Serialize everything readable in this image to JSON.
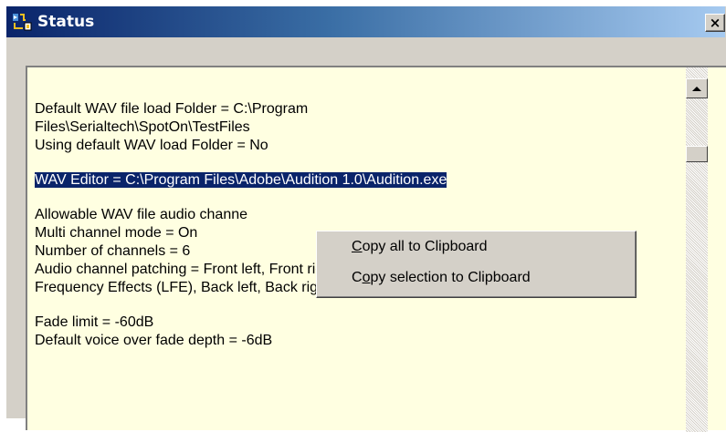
{
  "window": {
    "title": "Status",
    "close_label": "×"
  },
  "status_text": {
    "lines": [
      "Default WAV file load Folder = C:\\Program",
      "Files\\Serialtech\\SpotOn\\TestFiles",
      "Using default WAV load Folder = No",
      "",
      "WAV Editor = C:\\Program Files\\Adobe\\Audition 1.0\\Audition.exe",
      "",
      "Allowable WAV file audio channe",
      "Multi channel mode = On",
      "Number of channels = 6",
      "Audio channel patching = Front left, Front right, Front centre, Low",
      "Frequency Effects (LFE), Back left, Back right",
      "",
      "Fade limit = -60dB",
      "Default voice over fade depth = -6dB"
    ],
    "selected_line_index": 4
  },
  "context_menu": {
    "items": [
      {
        "mnemonic": "C",
        "rest": "opy all to Clipboard"
      },
      {
        "prefix": "C",
        "mnemonic": "o",
        "rest": "py selection to Clipboard"
      }
    ]
  },
  "colors": {
    "text_background": "#ffffe1",
    "selection": "#0a246a",
    "title_gradient_start": "#0a246a",
    "title_gradient_end": "#a6caf0"
  },
  "icons": {
    "app": "spoton-app-icon",
    "close": "close-icon",
    "scroll_up": "arrow-up-icon"
  }
}
